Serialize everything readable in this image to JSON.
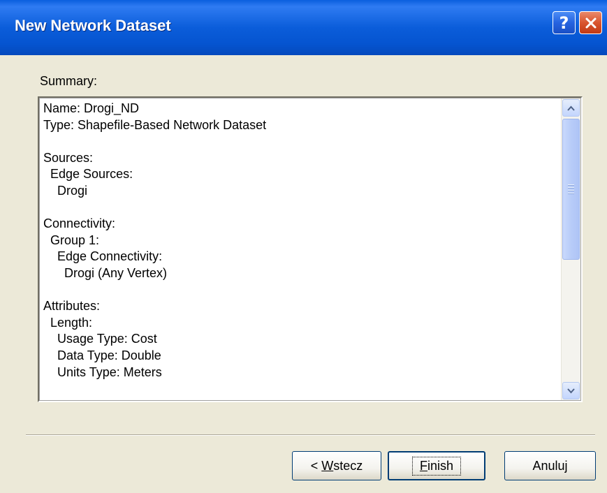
{
  "window": {
    "title": "New Network Dataset",
    "help_glyph": "?",
    "colors": {
      "titlebar": "#0554D0",
      "face": "#ECE9D8",
      "close": "#D9552F"
    }
  },
  "summary": {
    "label": "Summary:",
    "lines": [
      "Name: Drogi_ND",
      "Type: Shapefile-Based Network Dataset",
      "",
      "Sources:",
      "  Edge Sources:",
      "    Drogi",
      "",
      "Connectivity:",
      "  Group 1:",
      "    Edge Connectivity:",
      "      Drogi (Any Vertex)",
      "",
      "Attributes:",
      "  Length:",
      "    Usage Type: Cost",
      "    Data Type: Double",
      "    Units Type: Meters"
    ]
  },
  "buttons": {
    "back_prefix": "< ",
    "back_mnemonic": "W",
    "back_rest": "stecz",
    "finish_mnemonic": "F",
    "finish_rest": "inish",
    "cancel": "Anuluj"
  },
  "icons": [
    "help-icon",
    "close-icon",
    "scroll-up-icon",
    "scroll-down-icon",
    "scroll-grip-icon"
  ]
}
